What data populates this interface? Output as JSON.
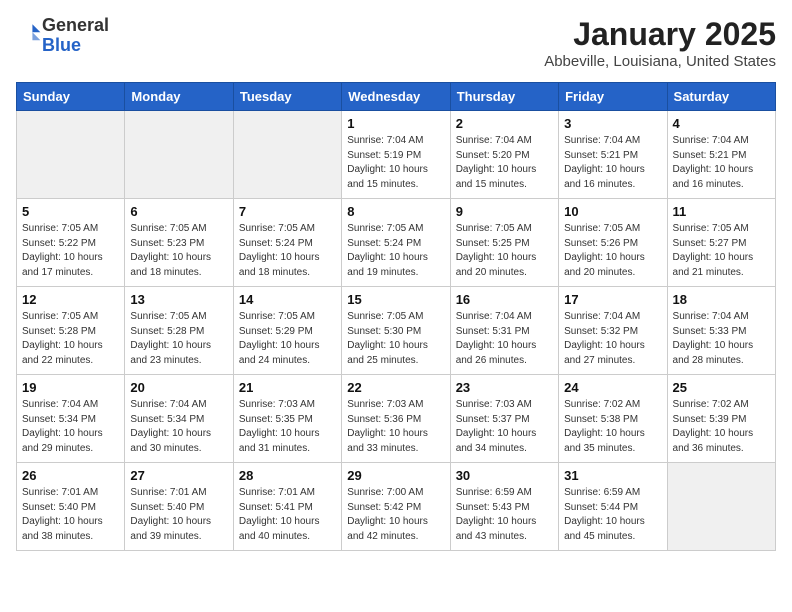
{
  "logo": {
    "general": "General",
    "blue": "Blue"
  },
  "header": {
    "title": "January 2025",
    "subtitle": "Abbeville, Louisiana, United States"
  },
  "weekdays": [
    "Sunday",
    "Monday",
    "Tuesday",
    "Wednesday",
    "Thursday",
    "Friday",
    "Saturday"
  ],
  "weeks": [
    [
      {
        "day": "",
        "info": ""
      },
      {
        "day": "",
        "info": ""
      },
      {
        "day": "",
        "info": ""
      },
      {
        "day": "1",
        "info": "Sunrise: 7:04 AM\nSunset: 5:19 PM\nDaylight: 10 hours\nand 15 minutes."
      },
      {
        "day": "2",
        "info": "Sunrise: 7:04 AM\nSunset: 5:20 PM\nDaylight: 10 hours\nand 15 minutes."
      },
      {
        "day": "3",
        "info": "Sunrise: 7:04 AM\nSunset: 5:21 PM\nDaylight: 10 hours\nand 16 minutes."
      },
      {
        "day": "4",
        "info": "Sunrise: 7:04 AM\nSunset: 5:21 PM\nDaylight: 10 hours\nand 16 minutes."
      }
    ],
    [
      {
        "day": "5",
        "info": "Sunrise: 7:05 AM\nSunset: 5:22 PM\nDaylight: 10 hours\nand 17 minutes."
      },
      {
        "day": "6",
        "info": "Sunrise: 7:05 AM\nSunset: 5:23 PM\nDaylight: 10 hours\nand 18 minutes."
      },
      {
        "day": "7",
        "info": "Sunrise: 7:05 AM\nSunset: 5:24 PM\nDaylight: 10 hours\nand 18 minutes."
      },
      {
        "day": "8",
        "info": "Sunrise: 7:05 AM\nSunset: 5:24 PM\nDaylight: 10 hours\nand 19 minutes."
      },
      {
        "day": "9",
        "info": "Sunrise: 7:05 AM\nSunset: 5:25 PM\nDaylight: 10 hours\nand 20 minutes."
      },
      {
        "day": "10",
        "info": "Sunrise: 7:05 AM\nSunset: 5:26 PM\nDaylight: 10 hours\nand 20 minutes."
      },
      {
        "day": "11",
        "info": "Sunrise: 7:05 AM\nSunset: 5:27 PM\nDaylight: 10 hours\nand 21 minutes."
      }
    ],
    [
      {
        "day": "12",
        "info": "Sunrise: 7:05 AM\nSunset: 5:28 PM\nDaylight: 10 hours\nand 22 minutes."
      },
      {
        "day": "13",
        "info": "Sunrise: 7:05 AM\nSunset: 5:28 PM\nDaylight: 10 hours\nand 23 minutes."
      },
      {
        "day": "14",
        "info": "Sunrise: 7:05 AM\nSunset: 5:29 PM\nDaylight: 10 hours\nand 24 minutes."
      },
      {
        "day": "15",
        "info": "Sunrise: 7:05 AM\nSunset: 5:30 PM\nDaylight: 10 hours\nand 25 minutes."
      },
      {
        "day": "16",
        "info": "Sunrise: 7:04 AM\nSunset: 5:31 PM\nDaylight: 10 hours\nand 26 minutes."
      },
      {
        "day": "17",
        "info": "Sunrise: 7:04 AM\nSunset: 5:32 PM\nDaylight: 10 hours\nand 27 minutes."
      },
      {
        "day": "18",
        "info": "Sunrise: 7:04 AM\nSunset: 5:33 PM\nDaylight: 10 hours\nand 28 minutes."
      }
    ],
    [
      {
        "day": "19",
        "info": "Sunrise: 7:04 AM\nSunset: 5:34 PM\nDaylight: 10 hours\nand 29 minutes."
      },
      {
        "day": "20",
        "info": "Sunrise: 7:04 AM\nSunset: 5:34 PM\nDaylight: 10 hours\nand 30 minutes."
      },
      {
        "day": "21",
        "info": "Sunrise: 7:03 AM\nSunset: 5:35 PM\nDaylight: 10 hours\nand 31 minutes."
      },
      {
        "day": "22",
        "info": "Sunrise: 7:03 AM\nSunset: 5:36 PM\nDaylight: 10 hours\nand 33 minutes."
      },
      {
        "day": "23",
        "info": "Sunrise: 7:03 AM\nSunset: 5:37 PM\nDaylight: 10 hours\nand 34 minutes."
      },
      {
        "day": "24",
        "info": "Sunrise: 7:02 AM\nSunset: 5:38 PM\nDaylight: 10 hours\nand 35 minutes."
      },
      {
        "day": "25",
        "info": "Sunrise: 7:02 AM\nSunset: 5:39 PM\nDaylight: 10 hours\nand 36 minutes."
      }
    ],
    [
      {
        "day": "26",
        "info": "Sunrise: 7:01 AM\nSunset: 5:40 PM\nDaylight: 10 hours\nand 38 minutes."
      },
      {
        "day": "27",
        "info": "Sunrise: 7:01 AM\nSunset: 5:40 PM\nDaylight: 10 hours\nand 39 minutes."
      },
      {
        "day": "28",
        "info": "Sunrise: 7:01 AM\nSunset: 5:41 PM\nDaylight: 10 hours\nand 40 minutes."
      },
      {
        "day": "29",
        "info": "Sunrise: 7:00 AM\nSunset: 5:42 PM\nDaylight: 10 hours\nand 42 minutes."
      },
      {
        "day": "30",
        "info": "Sunrise: 6:59 AM\nSunset: 5:43 PM\nDaylight: 10 hours\nand 43 minutes."
      },
      {
        "day": "31",
        "info": "Sunrise: 6:59 AM\nSunset: 5:44 PM\nDaylight: 10 hours\nand 45 minutes."
      },
      {
        "day": "",
        "info": ""
      }
    ]
  ]
}
